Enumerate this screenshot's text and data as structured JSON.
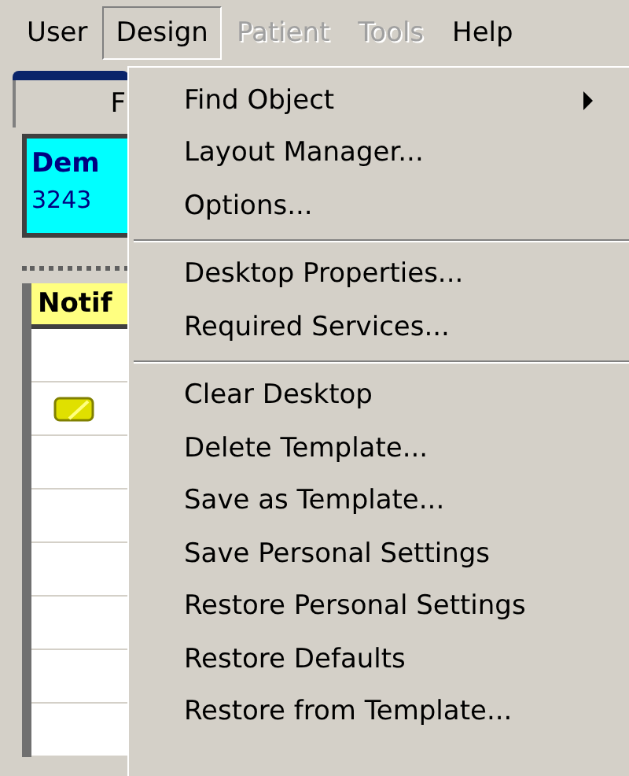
{
  "menubar": [
    {
      "label": "User",
      "selected": false,
      "disabled": false
    },
    {
      "label": "Design",
      "selected": true,
      "disabled": false
    },
    {
      "label": "Patient",
      "selected": false,
      "disabled": true
    },
    {
      "label": "Tools",
      "selected": false,
      "disabled": true
    },
    {
      "label": "Help",
      "selected": false,
      "disabled": false
    }
  ],
  "panel": {
    "header": "F",
    "card": {
      "title": "Dem",
      "number": "3243"
    },
    "table": {
      "column_1": "Notif",
      "rows": [
        {
          "flag": false
        },
        {
          "flag": true
        },
        {
          "flag": false
        },
        {
          "flag": false
        },
        {
          "flag": false
        },
        {
          "flag": false
        },
        {
          "flag": false
        },
        {
          "flag": false
        }
      ]
    }
  },
  "menu": {
    "groups": [
      [
        {
          "label": "Find Object",
          "submenu": true
        },
        {
          "label": "Layout Manager...",
          "submenu": false
        },
        {
          "label": "Options...",
          "submenu": false
        }
      ],
      [
        {
          "label": "Desktop Properties...",
          "submenu": false
        },
        {
          "label": "Required Services...",
          "submenu": false
        }
      ],
      [
        {
          "label": "Clear Desktop",
          "submenu": false
        },
        {
          "label": "Delete Template...",
          "submenu": false
        },
        {
          "label": "Save as Template...",
          "submenu": false
        },
        {
          "label": "Save Personal Settings",
          "submenu": false
        },
        {
          "label": "Restore Personal Settings",
          "submenu": false
        },
        {
          "label": "Restore Defaults",
          "submenu": false
        },
        {
          "label": "Restore from Template...",
          "submenu": false
        }
      ]
    ]
  }
}
